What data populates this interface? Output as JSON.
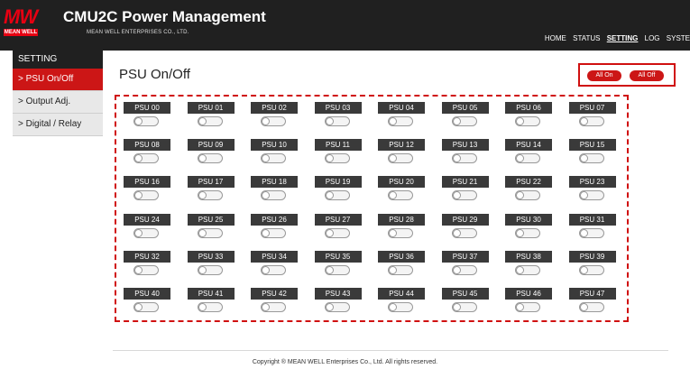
{
  "header": {
    "logo_text": "MW",
    "brand_text": "MEAN WELL",
    "title": "CMU2C Power Management",
    "company": "MEAN WELL ENTERPRISES CO., LTD.",
    "nav": [
      "HOME",
      "STATUS",
      "SETTING",
      "LOG",
      "SYSTE"
    ],
    "active_nav": "SETTING"
  },
  "sidebar": {
    "heading": "SETTING",
    "items": [
      {
        "label": "> PSU On/Off",
        "active": true
      },
      {
        "label": "> Output Adj.",
        "active": false
      },
      {
        "label": "> Digital / Relay",
        "active": false
      }
    ]
  },
  "main": {
    "title": "PSU On/Off",
    "all_on_label": "All On",
    "all_off_label": "All Off",
    "psus": [
      "PSU 00",
      "PSU 01",
      "PSU 02",
      "PSU 03",
      "PSU 04",
      "PSU 05",
      "PSU 06",
      "PSU 07",
      "PSU 08",
      "PSU 09",
      "PSU 10",
      "PSU 11",
      "PSU 12",
      "PSU 13",
      "PSU 14",
      "PSU 15",
      "PSU 16",
      "PSU 17",
      "PSU 18",
      "PSU 19",
      "PSU 20",
      "PSU 21",
      "PSU 22",
      "PSU 23",
      "PSU 24",
      "PSU 25",
      "PSU 26",
      "PSU 27",
      "PSU 28",
      "PSU 29",
      "PSU 30",
      "PSU 31",
      "PSU 32",
      "PSU 33",
      "PSU 34",
      "PSU 35",
      "PSU 36",
      "PSU 37",
      "PSU 38",
      "PSU 39",
      "PSU 40",
      "PSU 41",
      "PSU 42",
      "PSU 43",
      "PSU 44",
      "PSU 45",
      "PSU 46",
      "PSU 47"
    ],
    "switch_state": "off"
  },
  "footer": {
    "copyright": "Copyright ® MEAN WELL Enterprises Co., Ltd. All rights reserved."
  },
  "colors": {
    "accent": "#cc1616",
    "header_bg": "#202020",
    "label_bg": "#3a3a3a"
  }
}
